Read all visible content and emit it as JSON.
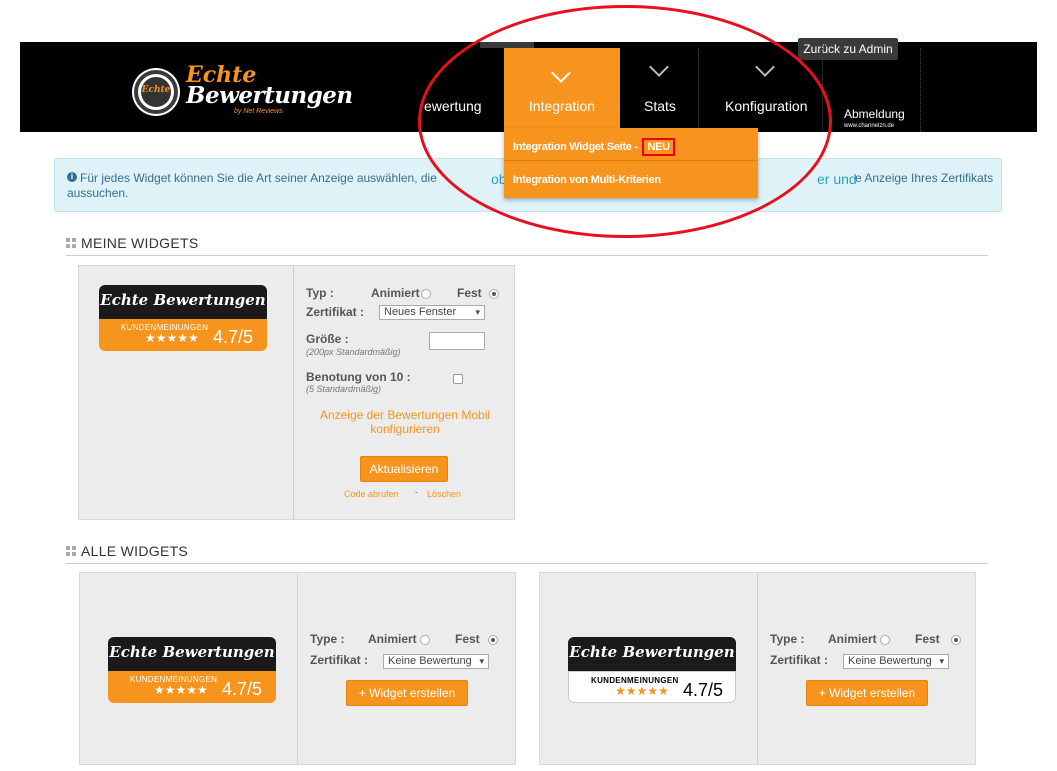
{
  "header": {
    "logo_line1": "Echte",
    "logo_line2": "Bewertungen",
    "logo_sub": "by Net Reviews",
    "logo_badge": "Echte",
    "admin_button": "Zurück zu Admin",
    "nav": {
      "bewertung_partial": "ewertung",
      "integration": "Integration",
      "stats": "Stats",
      "konfiguration": "Konfiguration"
    },
    "logout": "Abmeldung",
    "logout_sub": "www.channelzn.de"
  },
  "dropdown": {
    "item1": "Integration Widget Seite - ",
    "item1_badge": "NEU",
    "item2": "Integration von Multi-Kriterien"
  },
  "info": {
    "icon": "info-icon",
    "line1": "Für jedes Widget können Sie die Art seiner Anzeige auswählen, die",
    "hidden1": "obilen W",
    "hidden2": "er und",
    "line1_end": "e Anzeige Ihres Zertifikats",
    "line2": "aussuchen."
  },
  "sections": {
    "mine": "MEINE WIDGETS",
    "all": "ALLE WIDGETS"
  },
  "my_widget": {
    "badge": {
      "brand": "Echte Bewertungen",
      "label": "KUNDENMEINUNGEN",
      "stars": "★★★★★",
      "score": "4.7/5"
    },
    "typ_label": "Typ :",
    "animiert": "Animiert",
    "fest": "Fest",
    "zertifikat_label": "Zertifikat :",
    "zertifikat_value": "Neues Fenster",
    "groesse_label": "Größe :",
    "groesse_hint": "(200px Standardmäßig)",
    "benotung_label": "Benotung von 10 :",
    "benotung_hint": "(5 Standardmäßig)",
    "mobile_link": "Anzeige der Bewertungen Mobil konfigurieren",
    "update_button": "Aktualisieren",
    "code_link": "Code abrufen",
    "delete_link": "Löschen",
    "separator": "-"
  },
  "all_widgets": [
    {
      "badge": {
        "brand": "Echte Bewertungen",
        "label": "KUNDENMEINUNGEN",
        "stars": "★★★★★",
        "score": "4.7/5"
      },
      "type_label": "Type :",
      "animiert": "Animiert",
      "fest": "Fest",
      "zertifikat_label": "Zertifikat :",
      "zertifikat_value": "Keine Bewertung",
      "create_button": "+ Widget erstellen"
    },
    {
      "badge": {
        "brand": "Echte Bewertungen",
        "label": "KUNDENMEINUNGEN",
        "stars": "★★★★★",
        "score": "4.7/5"
      },
      "type_label": "Type :",
      "animiert": "Animiert",
      "fest": "Fest",
      "zertifikat_label": "Zertifikat :",
      "zertifikat_value": "Keine Bewertung",
      "create_button": "+ Widget erstellen"
    }
  ],
  "colors": {
    "accent": "#f7941d",
    "header_bg": "#000000",
    "highlight": "#e8101c"
  }
}
